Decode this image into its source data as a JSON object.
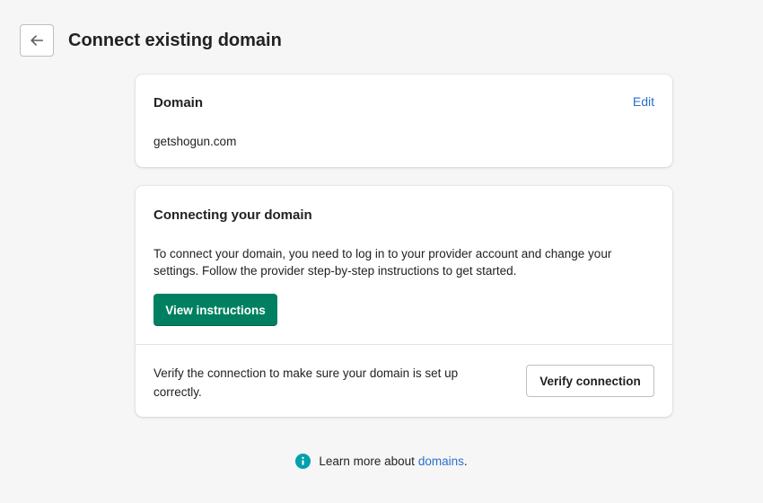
{
  "header": {
    "title": "Connect existing domain",
    "back_icon": "arrow-left-icon"
  },
  "domain_card": {
    "heading": "Domain",
    "edit_label": "Edit",
    "value": "getshogun.com"
  },
  "connect_card": {
    "heading": "Connecting your domain",
    "description": "To connect your domain, you need to log in to your provider account and change your settings. Follow the provider step-by-step instructions to get started.",
    "view_instructions_label": "View instructions",
    "verify_text": "Verify the connection to make sure your domain is set up correctly.",
    "verify_button_label": "Verify connection"
  },
  "footer": {
    "text": "Learn more about",
    "link_label": "domains",
    "suffix": ".",
    "icon": "info-icon"
  },
  "colors": {
    "primary": "#008060",
    "link": "#2c6ecb",
    "info": "#00a0ac",
    "background": "#f6f6f7"
  }
}
